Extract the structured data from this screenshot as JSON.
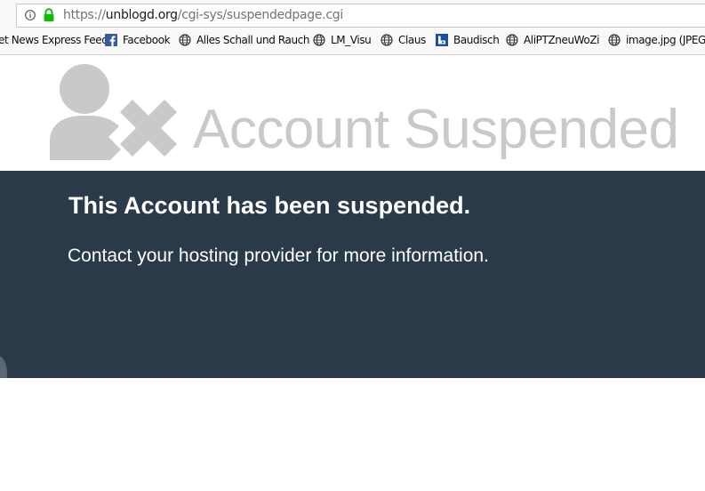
{
  "browser": {
    "url_prefix": "https://",
    "url_host": "unblogd.org",
    "url_path": "/cgi-sys/suspendedpage.cgi",
    "bookmarks": [
      {
        "label": "et News Express Feed",
        "icon": "none"
      },
      {
        "label": "Facebook",
        "icon": "facebook-icon"
      },
      {
        "label": "Alles Schall und Rauch",
        "icon": "globe-icon"
      },
      {
        "label": "LM_Visu",
        "icon": "globe-icon"
      },
      {
        "label": "Claus",
        "icon": "globe-icon"
      },
      {
        "label": "Baudisch",
        "icon": "baudisch-icon"
      },
      {
        "label": "AliPTZneuWoZi",
        "icon": "globe-icon"
      },
      {
        "label": "image.jpg (JPEG-",
        "icon": "globe-icon"
      }
    ]
  },
  "page": {
    "headline": "Account Suspended",
    "title": "This Account has been suspended.",
    "message": "Contact your hosting provider for more information."
  },
  "colors": {
    "panel_bg": "#2a3a49",
    "headline": "#c9c9c9",
    "icon_gray": "#c9c9c9",
    "lock_green": "#12bc00",
    "facebook_blue": "#3b5998"
  }
}
